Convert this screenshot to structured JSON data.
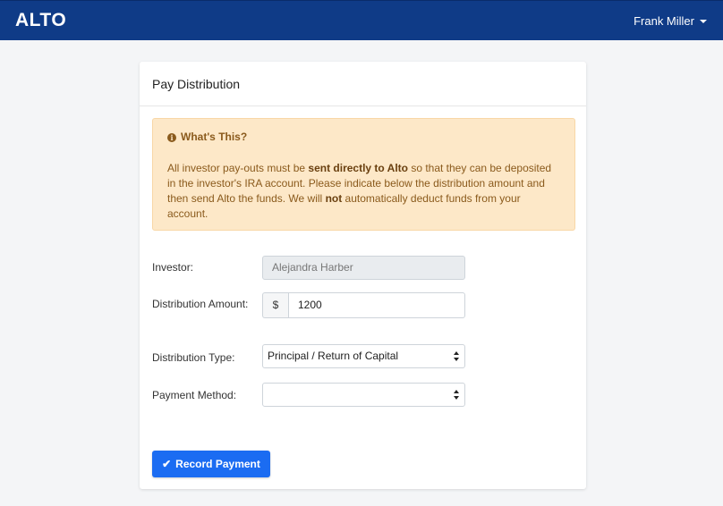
{
  "navbar": {
    "brand": "ALTO",
    "user_name": "Frank Miller",
    "bg_color": "#0f3b87"
  },
  "card": {
    "title": "Pay Distribution"
  },
  "alert": {
    "title": "What's This?",
    "text_1": "All investor pay-outs must be ",
    "bold_1": "sent directly to Alto",
    "text_2": " so that they can be deposited in the investor's IRA account. Please indicate below the distribution amount and then send Alto the funds. We will ",
    "bold_2": "not",
    "text_3": " automatically deduct funds from your account."
  },
  "form": {
    "investor_label": "Investor:",
    "investor_value": "Alejandra Harber",
    "amount_label": "Distribution Amount:",
    "amount_prefix": "$",
    "amount_value": "1200",
    "type_label": "Distribution Type:",
    "type_value": "Principal / Return of Capital",
    "method_label": "Payment Method:",
    "method_value": ""
  },
  "actions": {
    "record_label": "Record Payment",
    "primary_color": "#1b6cf2"
  }
}
